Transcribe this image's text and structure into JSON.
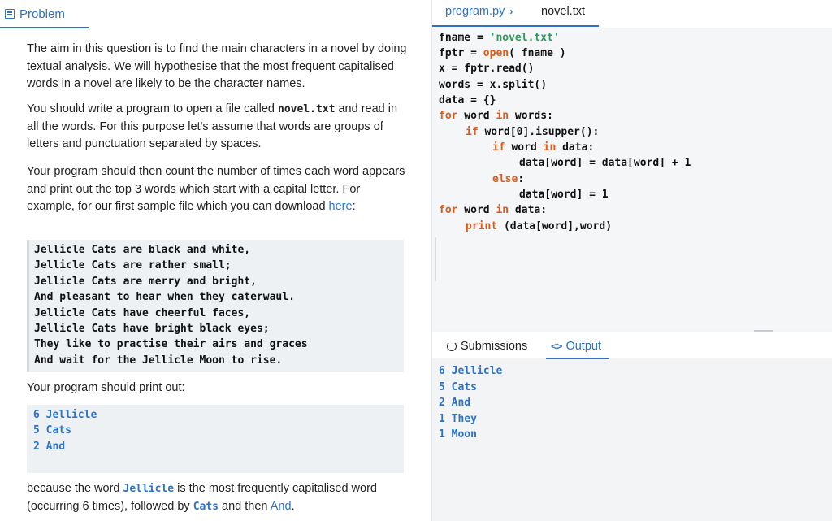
{
  "problem": {
    "tab_label": "Problem",
    "p1": "The aim in this question is to find the main characters in a novel by doing textual analysis. We will hypothesise that the most frequent capitalised words in a novel are likely to be the character names.",
    "p2_a": "You should write a program to open a file called ",
    "p2_code": "novel.txt",
    "p2_b": " and read in all the words. For this purpose let's assume that words are groups of letters and punctuation separated by spaces.",
    "p3_a": "Your program should then count the number of times each word appears and print out the top 3 words which start with a capital letter. For example, for our first sample file which you can download ",
    "p3_link": "here",
    "p3_b": ":",
    "sample_lines": [
      "Jellicle Cats are black and white,",
      "Jellicle Cats are rather small;",
      "Jellicle Cats are merry and bright,",
      "And pleasant to hear when they caterwaul.",
      "Jellicle Cats have cheerful faces,",
      "Jellicle Cats have bright black eyes;",
      "They like to practise their airs and graces",
      "And wait for the Jellicle Moon to rise."
    ],
    "print_intro": "Your program should print out:",
    "expected_lines": [
      "6 Jellicle",
      "5 Cats",
      "2 And"
    ],
    "p4_a": "because the word ",
    "p4_code1": "Jellicle",
    "p4_b": " is the most frequently capitalised word (occurring 6 times), followed by ",
    "p4_code2": "Cats",
    "p4_c": " and then ",
    "p4_code3": "And",
    "p4_d": "."
  },
  "editor": {
    "tabs": [
      {
        "label": "program.py",
        "chevron": "›"
      },
      {
        "label": "novel.txt"
      }
    ],
    "code": {
      "l1_a": "fname = ",
      "l1_str": "'novel.txt'",
      "l2_a": "fptr = ",
      "l2_kw": "open",
      "l2_b": "( fname )",
      "l3": "x = fptr.read()",
      "l4": "words = x.split()",
      "l5": "data = {}",
      "l6_kw1": "for",
      "l6_a": " word ",
      "l6_kw2": "in",
      "l6_b": " words:",
      "l7_kw": "if",
      "l7_a": " word[0].isupper():",
      "l8_kw1": "if",
      "l8_a": " word ",
      "l8_kw2": "in",
      "l8_b": " data:",
      "l9": "data[word] = data[word] + 1",
      "l10_kw": "else",
      "l10_a": ":",
      "l11": "data[word] = 1",
      "l12_kw1": "for",
      "l12_a": " word ",
      "l12_kw2": "in",
      "l12_b": " data:",
      "l13_kw": "print",
      "l13_a": " (data[word],word)"
    }
  },
  "lower": {
    "submissions_label": "Submissions",
    "output_icon": "<>",
    "output_label": "Output",
    "output_lines": [
      "6 Jellicle",
      "5 Cats",
      "2 And",
      "1 They",
      "1 Moon"
    ]
  },
  "colors": {
    "accent": "#2c72c7",
    "keyword": "#e05a1c",
    "string": "#2e9a58",
    "code_bg": "#eef1f4"
  },
  "icons": {
    "problem": "document-icon",
    "submissions": "history-icon",
    "output": "code-brackets-icon"
  }
}
